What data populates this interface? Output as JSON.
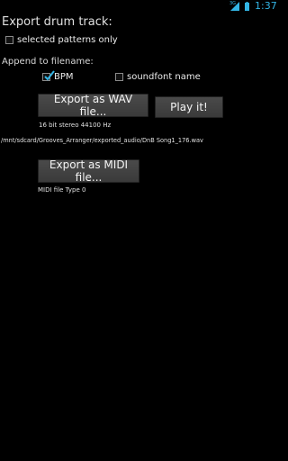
{
  "status_bar": {
    "network": "3G",
    "time": "1:37"
  },
  "title": "Export drum track:",
  "selected_patterns": {
    "label": "selected patterns only",
    "checked": false
  },
  "append_label": "Append to filename:",
  "bpm": {
    "label": "BPM",
    "checked": true
  },
  "soundfont": {
    "label": "soundfont name",
    "checked": false
  },
  "wav_button": "Export as WAV file...",
  "play_button": "Play it!",
  "wav_format": "16 bit stereo 44100 Hz",
  "wav_path": "/mnt/sdcard/Grooves_Arranger/exported_audio/DnB Song1_176.wav",
  "midi_button": "Export as MIDI file...",
  "midi_format": "MIDI file Type 0",
  "colors": {
    "accent": "#33b5e5",
    "background": "#000000",
    "button": "#424242"
  }
}
